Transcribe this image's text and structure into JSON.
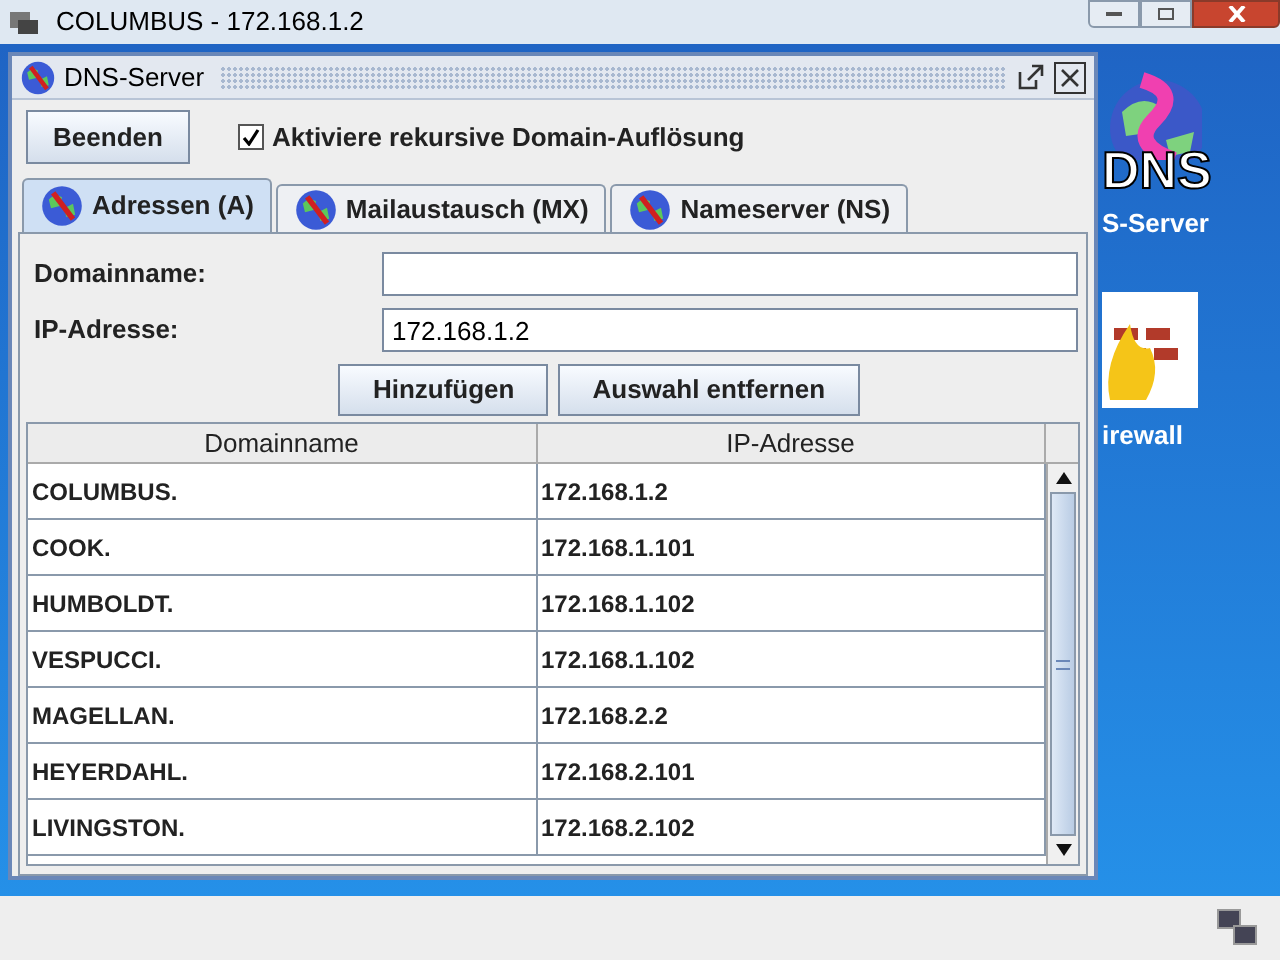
{
  "window": {
    "title": "COLUMBUS - 172.168.1.2"
  },
  "desktop_icons": [
    {
      "kind": "dns",
      "badge": "DNS",
      "label": "S-Server"
    },
    {
      "kind": "firewall",
      "label": "irewall"
    }
  ],
  "dialog": {
    "title": "DNS-Server",
    "quit_button": "Beenden",
    "recursive": {
      "label": "Aktiviere rekursive Domain-Auflösung",
      "checked": true
    },
    "tabs": [
      {
        "label": "Adressen (A)",
        "selected": true
      },
      {
        "label": "Mailaustausch (MX)",
        "selected": false
      },
      {
        "label": "Nameserver (NS)",
        "selected": false
      }
    ],
    "fields": [
      {
        "label": "Domainname:"
      },
      {
        "label": "IP-Adresse:",
        "value": "172.168.1.2"
      }
    ],
    "buttons": [
      "Hinzufügen",
      "Auswahl entfernen"
    ],
    "table": {
      "columns": [
        "Domainname",
        "IP-Adresse"
      ],
      "rows": [
        [
          "COLUMBUS.",
          "172.168.1.2"
        ],
        [
          "COOK.",
          "172.168.1.101"
        ],
        [
          "HUMBOLDT.",
          "172.168.1.102"
        ],
        [
          "VESPUCCI.",
          "172.168.1.102"
        ],
        [
          "MAGELLAN.",
          "172.168.2.2"
        ],
        [
          "HEYERDAHL.",
          "172.168.2.101"
        ],
        [
          "LIVINGSTON.",
          "172.168.2.102"
        ]
      ]
    }
  }
}
